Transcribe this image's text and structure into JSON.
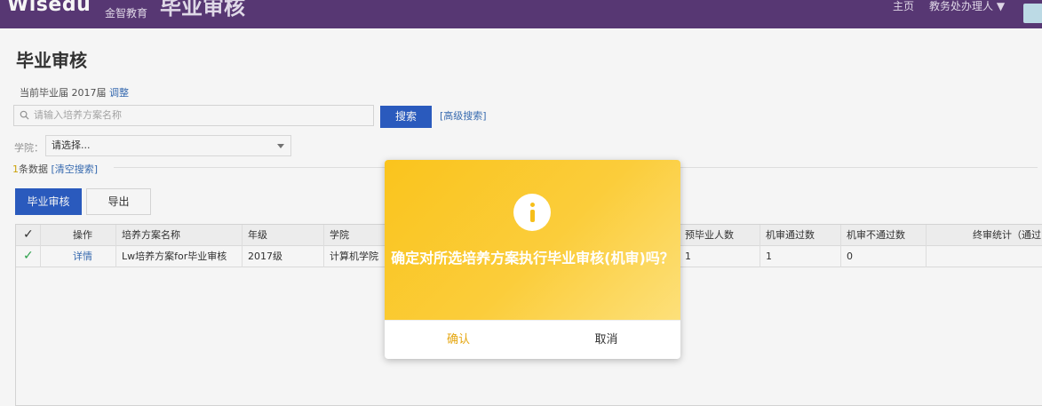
{
  "header": {
    "brand": "Wisedu",
    "brand_sub": "金智教育",
    "app_title": "毕业审核",
    "home_link": "主页",
    "user": "教务处办理人 ▼"
  },
  "page": {
    "title": "毕业审核",
    "graduation_label": "当前毕业届",
    "graduation_year": "2017届",
    "adjust_link": "调整"
  },
  "search": {
    "placeholder": "请输入培养方案名称",
    "button": "搜索",
    "advanced": "[高级搜索]"
  },
  "filter": {
    "college_label": "学院：",
    "college_value": "请选择..."
  },
  "results": {
    "count": "1",
    "count_suffix": "条数据",
    "clear_link": "[清空搜索]"
  },
  "toolbar": {
    "audit_button": "毕业审核",
    "export_button": "导出"
  },
  "table": {
    "headers": {
      "check": "✓",
      "action": "操作",
      "plan": "培养方案名称",
      "grade": "年级",
      "college": "学院",
      "expected": "预毕业人数",
      "machine_pass": "机审通过数",
      "machine_fail": "机审不通过数",
      "final": "终审统计（通过"
    },
    "rows": [
      {
        "check": "✓",
        "action": "详情",
        "plan": "Lw培养方案for毕业审核",
        "grade": "2017级",
        "college": "计算机学院",
        "expected": "1",
        "machine_pass": "1",
        "machine_fail": "0",
        "final": ""
      }
    ]
  },
  "dialog": {
    "message": "确定对所选培养方案执行毕业审核(机审)吗？",
    "confirm": "确认",
    "cancel": "取消"
  },
  "colors": {
    "header_bg": "#5b3a78",
    "primary_button": "#2c5ec5",
    "dialog_yellow": "#fac41d",
    "confirm_text": "#e5a610",
    "check_green": "#2fa84f",
    "link_blue": "#3a6fb7"
  }
}
